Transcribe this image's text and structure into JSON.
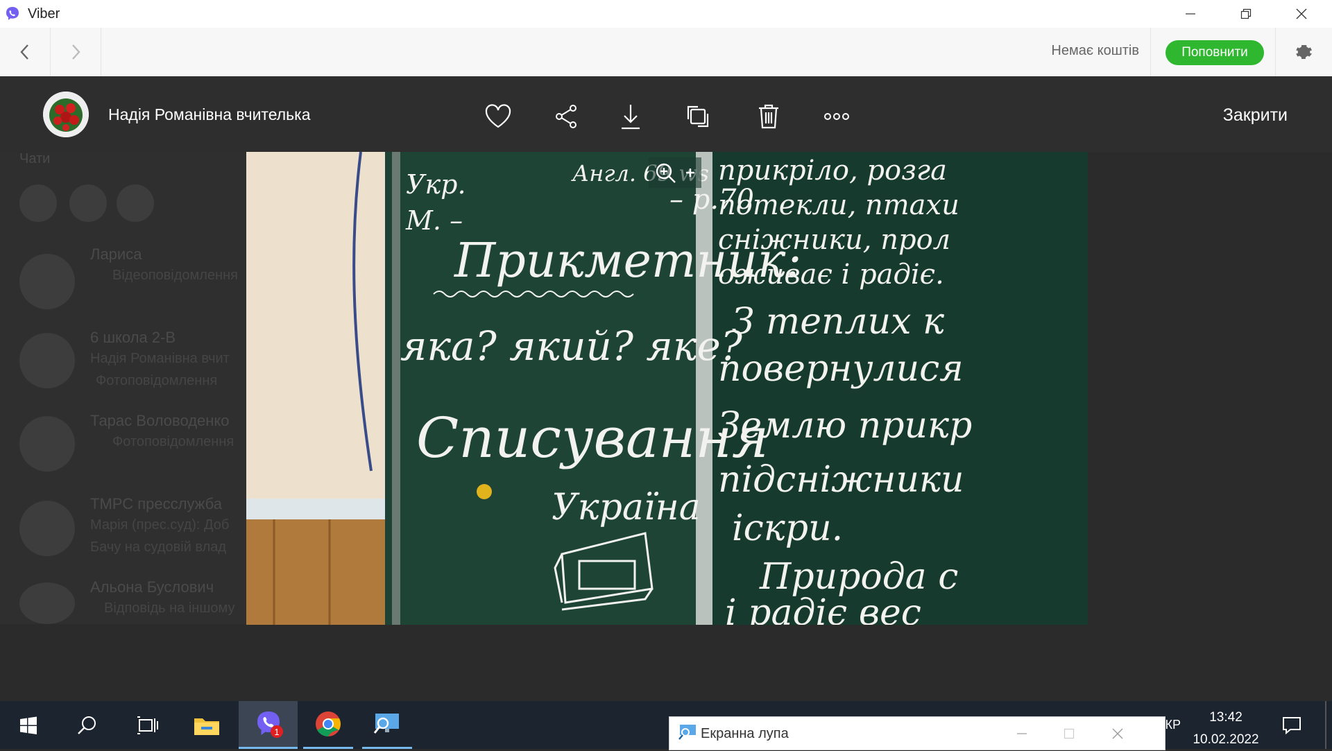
{
  "window": {
    "title": "Viber"
  },
  "nav": {
    "balance_text": "Немає коштів",
    "topup_label": "Поповнити"
  },
  "chatlist": {
    "section_label": "Чати",
    "chats": [
      {
        "name": "Лариса",
        "preview": "Відеоповідомлення"
      },
      {
        "name": "6 школа 2-В",
        "preview": "Надія Романівна вчит",
        "preview2": "Фотоповідомлення"
      },
      {
        "name": "Тарас Воловоденко",
        "preview": "Фотоповідомлення"
      },
      {
        "name": "ТМРС пресслужба",
        "preview": "Марія (прес.суд): Доб",
        "preview2": "Бачу на судовій влад"
      },
      {
        "name": "Альона Буслович",
        "preview": "Відповідь на іншому"
      }
    ]
  },
  "viewer": {
    "sender_name": "Надія Романівна вчителька",
    "close_label": "Закрити",
    "tools": [
      "heart-icon",
      "share-icon",
      "download-icon",
      "rotate-icon",
      "trash-icon",
      "more-icon"
    ]
  },
  "photo": {
    "board_lines": [
      "Укр.",
      "М. –",
      "Англ. 69 ws",
      "– р.70",
      "Прикметник:",
      "яка? який? яке?",
      "Списування",
      "Україна"
    ],
    "right_lines": [
      "прикріло, розга",
      "потекли, птахи",
      "сніжники, прол",
      "оживає і радіє.",
      "З теплих к",
      "повернулися",
      "Землю прикр",
      "підсніжники",
      "іскри.",
      "Природа с",
      "і радіє вес"
    ]
  },
  "taskbar": {
    "viber_badge": "1",
    "magnifier_title": "Екранна лупа",
    "lang": "УКР",
    "time": "13:42",
    "date": "10.02.2022"
  }
}
